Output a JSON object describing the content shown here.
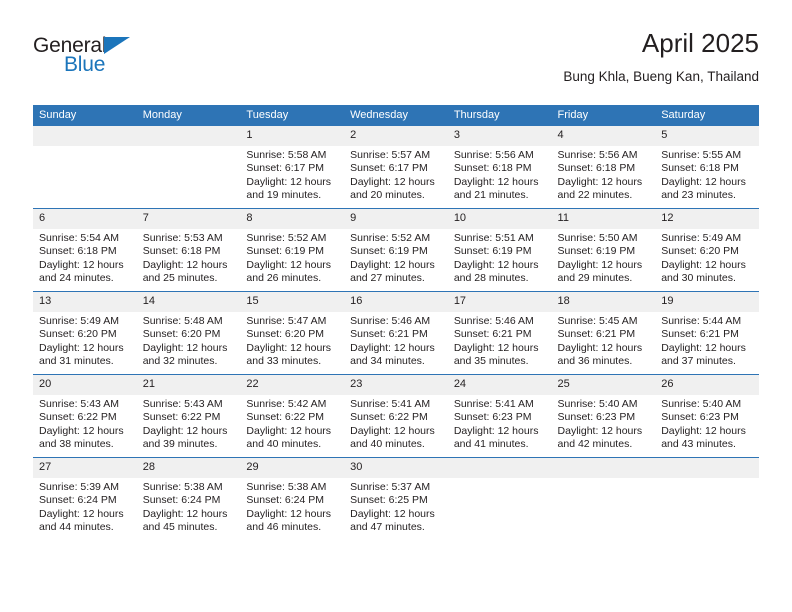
{
  "brand": {
    "name_part1": "General",
    "name_part2": "Blue",
    "triangle_icon": "triangle-icon"
  },
  "header": {
    "title": "April 2025",
    "subtitle": "Bung Khla, Bueng Kan, Thailand"
  },
  "colors": {
    "header_blue": "#2e74b5",
    "brand_blue": "#1b75bb",
    "daynum_band": "#f0f0f0",
    "text": "#231f20"
  },
  "weekday_headers": [
    "Sunday",
    "Monday",
    "Tuesday",
    "Wednesday",
    "Thursday",
    "Friday",
    "Saturday"
  ],
  "labels": {
    "sunrise_prefix": "Sunrise:",
    "sunset_prefix": "Sunset:",
    "daylight_prefix": "Daylight:"
  },
  "weeks": [
    [
      {
        "day": "",
        "sunrise": "",
        "sunset": "",
        "daylight": ""
      },
      {
        "day": "",
        "sunrise": "",
        "sunset": "",
        "daylight": ""
      },
      {
        "day": "1",
        "sunrise": "Sunrise: 5:58 AM",
        "sunset": "Sunset: 6:17 PM",
        "daylight": "Daylight: 12 hours and 19 minutes."
      },
      {
        "day": "2",
        "sunrise": "Sunrise: 5:57 AM",
        "sunset": "Sunset: 6:17 PM",
        "daylight": "Daylight: 12 hours and 20 minutes."
      },
      {
        "day": "3",
        "sunrise": "Sunrise: 5:56 AM",
        "sunset": "Sunset: 6:18 PM",
        "daylight": "Daylight: 12 hours and 21 minutes."
      },
      {
        "day": "4",
        "sunrise": "Sunrise: 5:56 AM",
        "sunset": "Sunset: 6:18 PM",
        "daylight": "Daylight: 12 hours and 22 minutes."
      },
      {
        "day": "5",
        "sunrise": "Sunrise: 5:55 AM",
        "sunset": "Sunset: 6:18 PM",
        "daylight": "Daylight: 12 hours and 23 minutes."
      }
    ],
    [
      {
        "day": "6",
        "sunrise": "Sunrise: 5:54 AM",
        "sunset": "Sunset: 6:18 PM",
        "daylight": "Daylight: 12 hours and 24 minutes."
      },
      {
        "day": "7",
        "sunrise": "Sunrise: 5:53 AM",
        "sunset": "Sunset: 6:18 PM",
        "daylight": "Daylight: 12 hours and 25 minutes."
      },
      {
        "day": "8",
        "sunrise": "Sunrise: 5:52 AM",
        "sunset": "Sunset: 6:19 PM",
        "daylight": "Daylight: 12 hours and 26 minutes."
      },
      {
        "day": "9",
        "sunrise": "Sunrise: 5:52 AM",
        "sunset": "Sunset: 6:19 PM",
        "daylight": "Daylight: 12 hours and 27 minutes."
      },
      {
        "day": "10",
        "sunrise": "Sunrise: 5:51 AM",
        "sunset": "Sunset: 6:19 PM",
        "daylight": "Daylight: 12 hours and 28 minutes."
      },
      {
        "day": "11",
        "sunrise": "Sunrise: 5:50 AM",
        "sunset": "Sunset: 6:19 PM",
        "daylight": "Daylight: 12 hours and 29 minutes."
      },
      {
        "day": "12",
        "sunrise": "Sunrise: 5:49 AM",
        "sunset": "Sunset: 6:20 PM",
        "daylight": "Daylight: 12 hours and 30 minutes."
      }
    ],
    [
      {
        "day": "13",
        "sunrise": "Sunrise: 5:49 AM",
        "sunset": "Sunset: 6:20 PM",
        "daylight": "Daylight: 12 hours and 31 minutes."
      },
      {
        "day": "14",
        "sunrise": "Sunrise: 5:48 AM",
        "sunset": "Sunset: 6:20 PM",
        "daylight": "Daylight: 12 hours and 32 minutes."
      },
      {
        "day": "15",
        "sunrise": "Sunrise: 5:47 AM",
        "sunset": "Sunset: 6:20 PM",
        "daylight": "Daylight: 12 hours and 33 minutes."
      },
      {
        "day": "16",
        "sunrise": "Sunrise: 5:46 AM",
        "sunset": "Sunset: 6:21 PM",
        "daylight": "Daylight: 12 hours and 34 minutes."
      },
      {
        "day": "17",
        "sunrise": "Sunrise: 5:46 AM",
        "sunset": "Sunset: 6:21 PM",
        "daylight": "Daylight: 12 hours and 35 minutes."
      },
      {
        "day": "18",
        "sunrise": "Sunrise: 5:45 AM",
        "sunset": "Sunset: 6:21 PM",
        "daylight": "Daylight: 12 hours and 36 minutes."
      },
      {
        "day": "19",
        "sunrise": "Sunrise: 5:44 AM",
        "sunset": "Sunset: 6:21 PM",
        "daylight": "Daylight: 12 hours and 37 minutes."
      }
    ],
    [
      {
        "day": "20",
        "sunrise": "Sunrise: 5:43 AM",
        "sunset": "Sunset: 6:22 PM",
        "daylight": "Daylight: 12 hours and 38 minutes."
      },
      {
        "day": "21",
        "sunrise": "Sunrise: 5:43 AM",
        "sunset": "Sunset: 6:22 PM",
        "daylight": "Daylight: 12 hours and 39 minutes."
      },
      {
        "day": "22",
        "sunrise": "Sunrise: 5:42 AM",
        "sunset": "Sunset: 6:22 PM",
        "daylight": "Daylight: 12 hours and 40 minutes."
      },
      {
        "day": "23",
        "sunrise": "Sunrise: 5:41 AM",
        "sunset": "Sunset: 6:22 PM",
        "daylight": "Daylight: 12 hours and 40 minutes."
      },
      {
        "day": "24",
        "sunrise": "Sunrise: 5:41 AM",
        "sunset": "Sunset: 6:23 PM",
        "daylight": "Daylight: 12 hours and 41 minutes."
      },
      {
        "day": "25",
        "sunrise": "Sunrise: 5:40 AM",
        "sunset": "Sunset: 6:23 PM",
        "daylight": "Daylight: 12 hours and 42 minutes."
      },
      {
        "day": "26",
        "sunrise": "Sunrise: 5:40 AM",
        "sunset": "Sunset: 6:23 PM",
        "daylight": "Daylight: 12 hours and 43 minutes."
      }
    ],
    [
      {
        "day": "27",
        "sunrise": "Sunrise: 5:39 AM",
        "sunset": "Sunset: 6:24 PM",
        "daylight": "Daylight: 12 hours and 44 minutes."
      },
      {
        "day": "28",
        "sunrise": "Sunrise: 5:38 AM",
        "sunset": "Sunset: 6:24 PM",
        "daylight": "Daylight: 12 hours and 45 minutes."
      },
      {
        "day": "29",
        "sunrise": "Sunrise: 5:38 AM",
        "sunset": "Sunset: 6:24 PM",
        "daylight": "Daylight: 12 hours and 46 minutes."
      },
      {
        "day": "30",
        "sunrise": "Sunrise: 5:37 AM",
        "sunset": "Sunset: 6:25 PM",
        "daylight": "Daylight: 12 hours and 47 minutes."
      },
      {
        "day": "",
        "sunrise": "",
        "sunset": "",
        "daylight": ""
      },
      {
        "day": "",
        "sunrise": "",
        "sunset": "",
        "daylight": ""
      },
      {
        "day": "",
        "sunrise": "",
        "sunset": "",
        "daylight": ""
      }
    ]
  ]
}
